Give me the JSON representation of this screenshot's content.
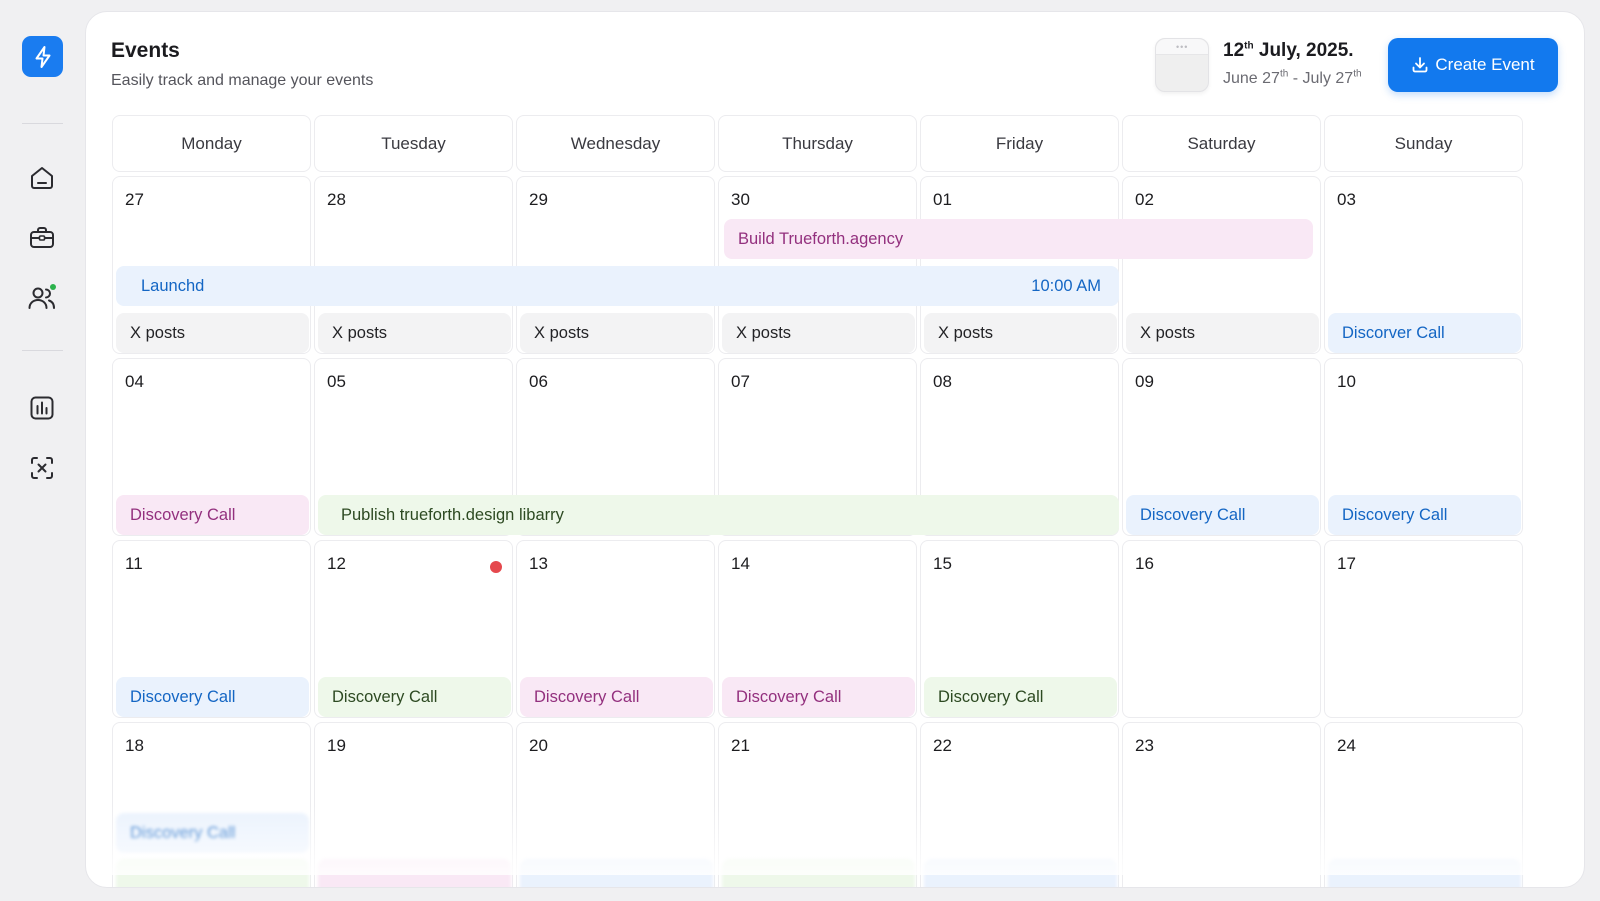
{
  "sidebar": {
    "logo_icon": "lightning-icon",
    "nav": [
      {
        "icon": "home-icon"
      },
      {
        "icon": "briefcase-icon"
      },
      {
        "icon": "users-icon",
        "has_dot": true
      },
      {
        "icon": "chart-icon"
      },
      {
        "icon": "scan-icon"
      }
    ]
  },
  "header": {
    "title": "Events",
    "subtitle": "Easily track and manage your events",
    "date_day": "12",
    "date_day_suffix": "th",
    "date_rest": " July, 2025.",
    "range_start": "June 27",
    "range_start_suffix": "th",
    "range_sep": " - July 27",
    "range_end_suffix": "th",
    "create_label": "Create Event"
  },
  "weekdays": [
    "Monday",
    "Tuesday",
    "Wednesday",
    "Thursday",
    "Friday",
    "Saturday",
    "Sunday"
  ],
  "weeks": [
    [
      "27",
      "28",
      "29",
      "30",
      "01",
      "02",
      "03"
    ],
    [
      "04",
      "05",
      "06",
      "07",
      "08",
      "09",
      "10"
    ],
    [
      "11",
      "12",
      "13",
      "14",
      "15",
      "16",
      "17"
    ],
    [
      "18",
      "19",
      "20",
      "21",
      "22",
      "23",
      "24"
    ]
  ],
  "today": "12",
  "events": {
    "build": "Build Trueforth.agency",
    "launchd": "Launchd",
    "launchd_time": "10:00 AM",
    "x_posts": "X posts",
    "discorver_call": "Discorver Call",
    "discovery_call": "Discovery Call",
    "publish": "Publish trueforth.design libarry"
  },
  "colors": {
    "accent": "#1279ee",
    "blue_event": "#eaf2fd",
    "pink_event": "#f9e8f5",
    "green_event": "#eef8ea",
    "gray_event": "#f3f3f4",
    "today_dot": "#e5484d"
  }
}
